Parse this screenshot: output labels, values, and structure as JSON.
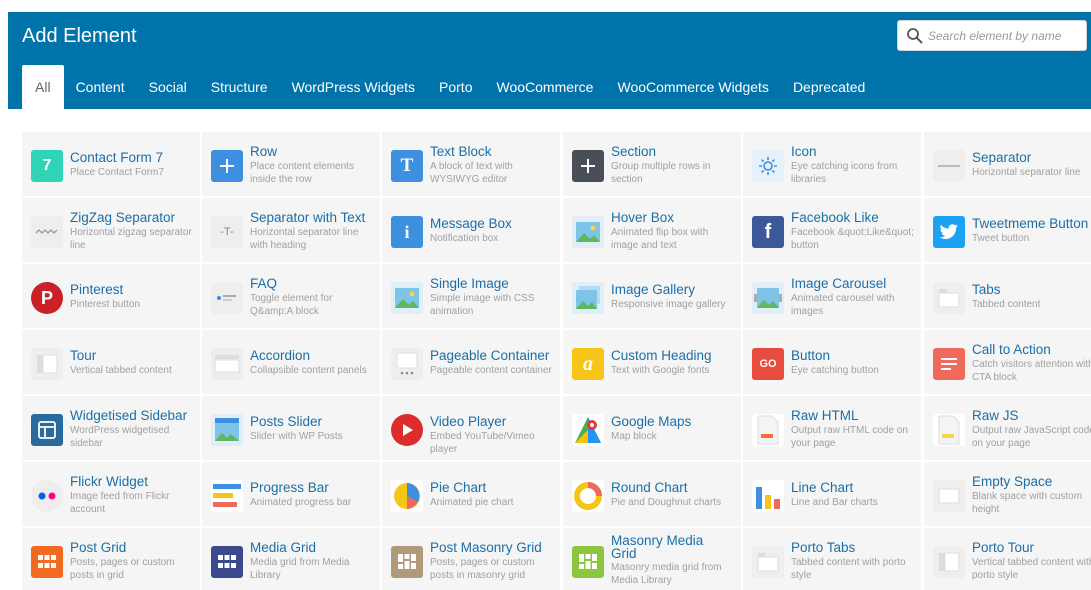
{
  "dialog": {
    "title": "Add Element",
    "search_placeholder": "Search element by name"
  },
  "tabs": [
    {
      "label": "All",
      "active": true
    },
    {
      "label": "Content"
    },
    {
      "label": "Social"
    },
    {
      "label": "Structure"
    },
    {
      "label": "WordPress Widgets"
    },
    {
      "label": "Porto"
    },
    {
      "label": "WooCommerce"
    },
    {
      "label": "WooCommerce Widgets"
    },
    {
      "label": "Deprecated"
    }
  ],
  "colors": {
    "header": "#0073aa",
    "name_text": "#1a6fa8",
    "desc_text": "#a0a0a0",
    "cell_bg": "#f5f5f5"
  },
  "elements": [
    [
      {
        "name": "Contact Form 7",
        "desc": "Place Contact Form7",
        "icon": "contact-form-7-icon"
      },
      {
        "name": "Row",
        "desc": "Place content elements inside the row",
        "icon": "plus-icon"
      },
      {
        "name": "Text Block",
        "desc": "A block of text with WYSIWYG editor",
        "icon": "text-t-icon"
      },
      {
        "name": "Section",
        "desc": "Group multiple rows in section",
        "icon": "plus-dark-icon"
      },
      {
        "name": "Icon",
        "desc": "Eye catching icons from libraries",
        "icon": "sun-icon"
      },
      {
        "name": "Separator",
        "desc": "Horizontal separator line",
        "icon": "separator-icon"
      }
    ],
    [
      {
        "name": "ZigZag Separator",
        "desc": "Horizontal zigzag separator line",
        "icon": "zigzag-icon"
      },
      {
        "name": "Separator with Text",
        "desc": "Horizontal separator line with heading",
        "icon": "separator-text-icon"
      },
      {
        "name": "Message Box",
        "desc": "Notification box",
        "icon": "info-icon"
      },
      {
        "name": "Hover Box",
        "desc": "Animated flip box with image and text",
        "icon": "hover-box-icon"
      },
      {
        "name": "Facebook Like",
        "desc": "Facebook &quot;Like&quot; button",
        "icon": "facebook-icon"
      },
      {
        "name": "Tweetmeme Button",
        "desc": "Tweet button",
        "icon": "twitter-icon"
      }
    ],
    [
      {
        "name": "Pinterest",
        "desc": "Pinterest button",
        "icon": "pinterest-icon"
      },
      {
        "name": "FAQ",
        "desc": "Toggle element for Q&amp;A block",
        "icon": "faq-icon"
      },
      {
        "name": "Single Image",
        "desc": "Simple image with CSS animation",
        "icon": "image-icon"
      },
      {
        "name": "Image Gallery",
        "desc": "Responsive image gallery",
        "icon": "gallery-icon"
      },
      {
        "name": "Image Carousel",
        "desc": "Animated carousel with images",
        "icon": "carousel-icon"
      },
      {
        "name": "Tabs",
        "desc": "Tabbed content",
        "icon": "tabs-icon"
      }
    ],
    [
      {
        "name": "Tour",
        "desc": "Vertical tabbed content",
        "icon": "tour-icon"
      },
      {
        "name": "Accordion",
        "desc": "Collapsible content panels",
        "icon": "accordion-icon"
      },
      {
        "name": "Pageable Container",
        "desc": "Pageable content container",
        "icon": "pageable-icon"
      },
      {
        "name": "Custom Heading",
        "desc": "Text with Google fonts",
        "icon": "heading-a-icon"
      },
      {
        "name": "Button",
        "desc": "Eye catching button",
        "icon": "go-button-icon"
      },
      {
        "name": "Call to Action",
        "desc": "Catch visitors attention with CTA block",
        "icon": "cta-icon"
      }
    ],
    [
      {
        "name": "Widgetised Sidebar",
        "desc": "WordPress widgetised sidebar",
        "icon": "sidebar-icon"
      },
      {
        "name": "Posts Slider",
        "desc": "Slider with WP Posts",
        "icon": "slider-icon"
      },
      {
        "name": "Video Player",
        "desc": "Embed YouTube/Vimeo player",
        "icon": "play-icon"
      },
      {
        "name": "Google Maps",
        "desc": "Map block",
        "icon": "map-icon"
      },
      {
        "name": "Raw HTML",
        "desc": "Output raw HTML code on your page",
        "icon": "raw-html-icon"
      },
      {
        "name": "Raw JS",
        "desc": "Output raw JavaScript code on your page",
        "icon": "raw-js-icon"
      }
    ],
    [
      {
        "name": "Flickr Widget",
        "desc": "Image feed from Flickr account",
        "icon": "flickr-icon"
      },
      {
        "name": "Progress Bar",
        "desc": "Animated progress bar",
        "icon": "progress-icon"
      },
      {
        "name": "Pie Chart",
        "desc": "Animated pie chart",
        "icon": "pie-chart-icon"
      },
      {
        "name": "Round Chart",
        "desc": "Pie and Doughnut charts",
        "icon": "round-chart-icon"
      },
      {
        "name": "Line Chart",
        "desc": "Line and Bar charts",
        "icon": "bar-chart-icon"
      },
      {
        "name": "Empty Space",
        "desc": "Blank space with custom height",
        "icon": "empty-space-icon"
      }
    ],
    [
      {
        "name": "Post Grid",
        "desc": "Posts, pages or custom posts in grid",
        "icon": "post-grid-icon"
      },
      {
        "name": "Media Grid",
        "desc": "Media grid from Media Library",
        "icon": "media-grid-icon"
      },
      {
        "name": "Post Masonry Grid",
        "desc": "Posts, pages or custom posts in masonry grid",
        "icon": "masonry-grid-icon"
      },
      {
        "name": "Masonry Media Grid",
        "desc": "Masonry media grid from Media Library",
        "icon": "masonry-media-icon"
      },
      {
        "name": "Porto Tabs",
        "desc": "Tabbed content with porto style",
        "icon": "porto-tabs-icon"
      },
      {
        "name": "Porto Tour",
        "desc": "Vertical tabbed content with porto style",
        "icon": "porto-tour-icon"
      }
    ]
  ]
}
